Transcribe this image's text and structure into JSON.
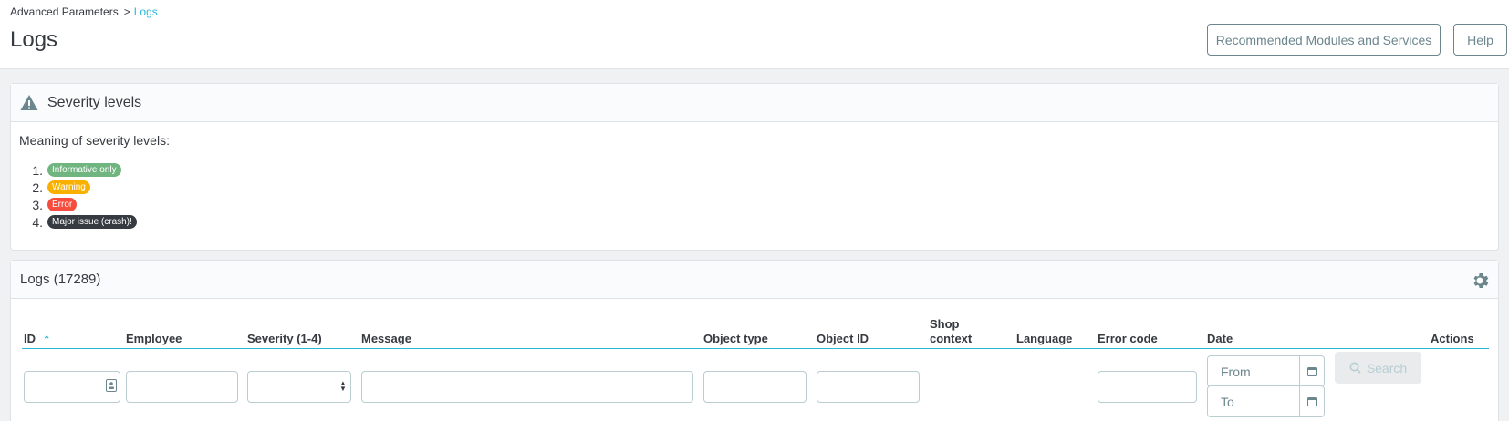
{
  "breadcrumb": {
    "parent": "Advanced Parameters",
    "separator": ">",
    "current": "Logs"
  },
  "header": {
    "title": "Logs",
    "recommended_label": "Recommended Modules and Services",
    "help_label": "Help"
  },
  "severity": {
    "title": "Severity levels",
    "intro": "Meaning of severity levels:",
    "items": [
      {
        "num": "1.",
        "label": "Informative only",
        "color": "#70b580"
      },
      {
        "num": "2.",
        "label": "Warning",
        "color": "#fab000"
      },
      {
        "num": "3.",
        "label": "Error",
        "color": "#f54c3e"
      },
      {
        "num": "4.",
        "label": "Major issue (crash)!",
        "color": "#363a41"
      }
    ]
  },
  "logs": {
    "title": "Logs (17289)",
    "columns": {
      "id": "ID",
      "employee": "Employee",
      "severity": "Severity (1-4)",
      "message": "Message",
      "object_type": "Object type",
      "object_id": "Object ID",
      "shop_context_1": "Shop",
      "shop_context_2": "context",
      "language": "Language",
      "error_code": "Error code",
      "date": "Date",
      "actions": "Actions"
    },
    "filters": {
      "date_from_placeholder": "From",
      "date_to_placeholder": "To",
      "search_label": "Search"
    }
  },
  "colors": {
    "accent": "#25b9d7",
    "text": "#363a41",
    "muted": "#6c868e"
  }
}
